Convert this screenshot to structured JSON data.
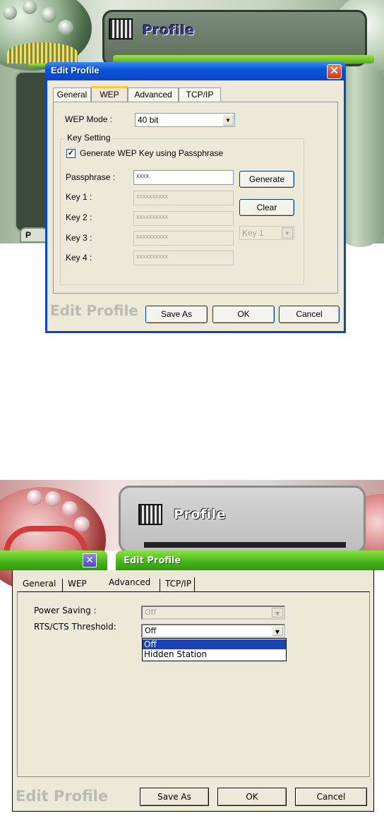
{
  "top": {
    "skin_title": "Profile",
    "dialog_title": "Edit Profile",
    "close_glyph": "✕",
    "tabs": [
      "General",
      "WEP",
      "Advanced",
      "TCP/IP"
    ],
    "active_tab": "WEP",
    "wep_mode_label": "WEP Mode :",
    "wep_mode_value": "40 bit",
    "key_setting_legend": "Key Setting",
    "generate_checkbox_label": "Generate WEP Key using Passphrase",
    "generate_checked": true,
    "passphrase_label": "Passphrase :",
    "passphrase_value": "xxxx",
    "keys": [
      {
        "label": "Key 1 :",
        "value": "xxxxxxxxxx"
      },
      {
        "label": "Key 2 :",
        "value": "xxxxxxxxxx"
      },
      {
        "label": "Key 3 :",
        "value": "xxxxxxxxxx"
      },
      {
        "label": "Key 4 :",
        "value": "xxxxxxxxxx"
      }
    ],
    "generate_button": "Generate",
    "clear_button": "Clear",
    "default_key_value": "Key 1",
    "watermark": "Edit Profile",
    "save_as_button": "Save As",
    "ok_button": "OK",
    "cancel_button": "Cancel",
    "skin_side_letter": "P"
  },
  "bottom": {
    "skin_title": "Profile",
    "dialog_title": "Edit Profile",
    "close_glyph": "✕",
    "tabs": [
      "General",
      "WEP",
      "Advanced",
      "TCP/IP"
    ],
    "active_tab": "Advanced",
    "power_saving_label": "Power Saving :",
    "power_saving_value": "Off",
    "rts_label": "RTS/CTS Threshold:",
    "rts_value": "Off",
    "rts_options": [
      "Off",
      "Hidden Station"
    ],
    "rts_selected_option": "Off",
    "watermark": "Edit Profile",
    "save_as_button": "Save As",
    "ok_button": "OK",
    "cancel_button": "Cancel"
  },
  "colors": {
    "xp_title_blue": "#0a46c8",
    "skin_green": "#4fae1c",
    "selection_blue": "#1a44b0",
    "dialog_face": "#ece9d8"
  }
}
